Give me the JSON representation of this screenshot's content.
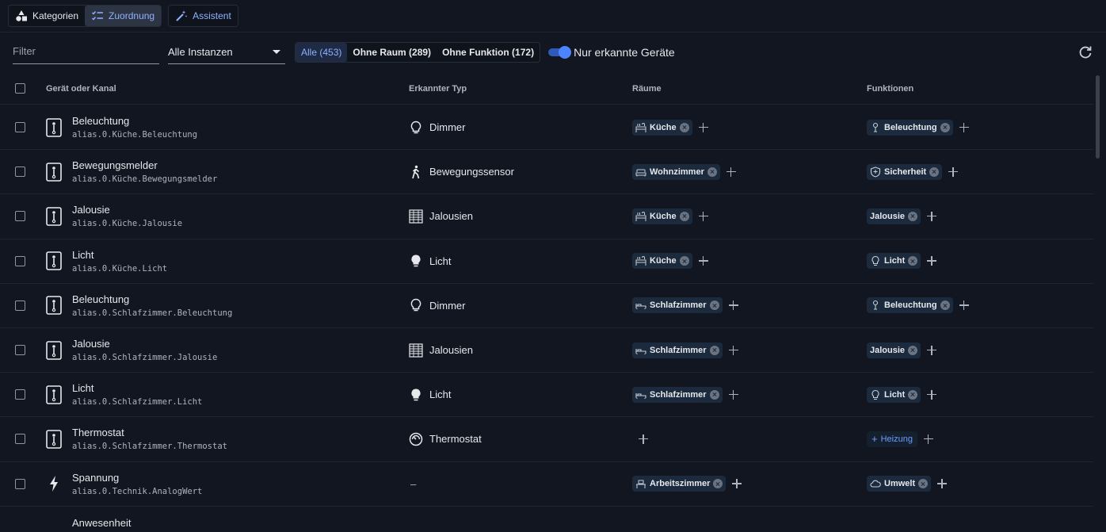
{
  "tabs": [
    {
      "label": "Kategorien",
      "icon": "shapes-icon"
    },
    {
      "label": "Zuordnung",
      "icon": "checklist-icon"
    },
    {
      "label": "Assistent",
      "icon": "magic-wand-icon"
    }
  ],
  "filter": {
    "placeholder": "Filter",
    "instance": "Alle Instanzen"
  },
  "segments": [
    "Alle (453)",
    "Ohne Raum (289)",
    "Ohne Funktion (172)"
  ],
  "toggle_label": "Nur erkannte Geräte",
  "headers": {
    "device": "Gerät oder Kanal",
    "type": "Erkannter Typ",
    "rooms": "Räume",
    "functions": "Funktionen"
  },
  "rows": [
    {
      "name": "Beleuchtung",
      "path": "alias.0.Küche.Beleuchtung",
      "type": "Dimmer",
      "type_icon": "bulb-outline-icon",
      "rooms": [
        {
          "label": "Küche",
          "icon": "kitchen-icon"
        }
      ],
      "functions": [
        {
          "label": "Beleuchtung",
          "icon": "lamp-icon"
        }
      ]
    },
    {
      "name": "Bewegungsmelder",
      "path": "alias.0.Küche.Bewegungsmelder",
      "type": "Bewegungssensor",
      "type_icon": "walking-icon",
      "rooms": [
        {
          "label": "Wohnzimmer",
          "icon": "sofa-icon"
        }
      ],
      "functions": [
        {
          "label": "Sicherheit",
          "icon": "shield-icon"
        }
      ]
    },
    {
      "name": "Jalousie",
      "path": "alias.0.Küche.Jalousie",
      "type": "Jalousien",
      "type_icon": "blinds-icon",
      "rooms": [
        {
          "label": "Küche",
          "icon": "kitchen-icon"
        }
      ],
      "functions": [
        {
          "label": "Jalousie",
          "icon": ""
        }
      ]
    },
    {
      "name": "Licht",
      "path": "alias.0.Küche.Licht",
      "type": "Licht",
      "type_icon": "bulb-icon",
      "rooms": [
        {
          "label": "Küche",
          "icon": "kitchen-icon"
        }
      ],
      "functions": [
        {
          "label": "Licht",
          "icon": "bulb-small-icon"
        }
      ]
    },
    {
      "name": "Beleuchtung",
      "path": "alias.0.Schlafzimmer.Beleuchtung",
      "type": "Dimmer",
      "type_icon": "bulb-outline-icon",
      "rooms": [
        {
          "label": "Schlafzimmer",
          "icon": "bed-icon"
        }
      ],
      "functions": [
        {
          "label": "Beleuchtung",
          "icon": "lamp-icon"
        }
      ]
    },
    {
      "name": "Jalousie",
      "path": "alias.0.Schlafzimmer.Jalousie",
      "type": "Jalousien",
      "type_icon": "blinds-icon",
      "rooms": [
        {
          "label": "Schlafzimmer",
          "icon": "bed-icon"
        }
      ],
      "functions": [
        {
          "label": "Jalousie",
          "icon": ""
        }
      ]
    },
    {
      "name": "Licht",
      "path": "alias.0.Schlafzimmer.Licht",
      "type": "Licht",
      "type_icon": "bulb-icon",
      "rooms": [
        {
          "label": "Schlafzimmer",
          "icon": "bed-icon"
        }
      ],
      "functions": [
        {
          "label": "Licht",
          "icon": "bulb-small-icon"
        }
      ]
    },
    {
      "name": "Thermostat",
      "path": "alias.0.Schlafzimmer.Thermostat",
      "type": "Thermostat",
      "type_icon": "thermostat-icon",
      "rooms": [],
      "functions": [],
      "suggestion": "Heizung"
    },
    {
      "name": "Spannung",
      "path": "alias.0.Technik.AnalogWert",
      "type": "–",
      "type_icon": "bolt-icon",
      "rooms": [
        {
          "label": "Arbeitszimmer",
          "icon": "desk-icon"
        }
      ],
      "functions": [
        {
          "label": "Umwelt",
          "icon": "cloud-icon"
        }
      ]
    }
  ],
  "partial_row": "Anwesenheit"
}
